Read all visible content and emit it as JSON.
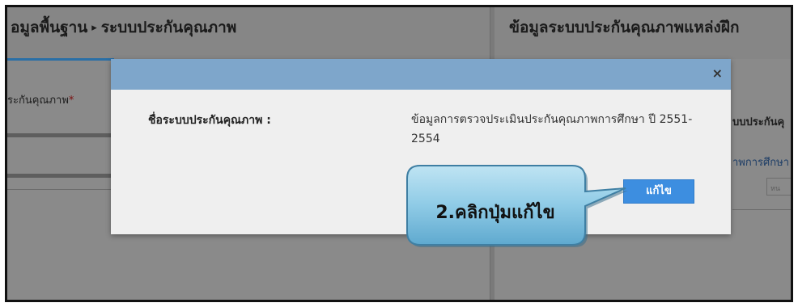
{
  "background": {
    "breadcrumb": [
      "อมูลพื้นฐาน",
      "ระบบประกันคุณภาพ"
    ],
    "breadcrumb_separator": "▸",
    "right_title": "ข้อมูลระบบประกันคุณภาพแหล่งฝึก",
    "left_field_label": "ระกันคุณภาพ",
    "required_mark": "*",
    "right_subheading": "บบประกันคุ",
    "right_link": "าพการศึกษา",
    "right_input_text": "หน"
  },
  "modal": {
    "close_icon": "×",
    "field_label": "ชื่อระบบประกันคุณภาพ :",
    "field_value": "ข้อมูลการตรวจประเมินประกันคุณภาพการศึกษา ปี 2551- 2554",
    "edit_button_label": "แก้ไข"
  },
  "callout": {
    "text": "2.คลิกปุ่มแก้ไข"
  },
  "colors": {
    "overlay": "#8a8a8a",
    "modal_header": "#7ea6cb",
    "edit_button": "#3d8ee0",
    "callout_fill": "#8fcbe6"
  }
}
